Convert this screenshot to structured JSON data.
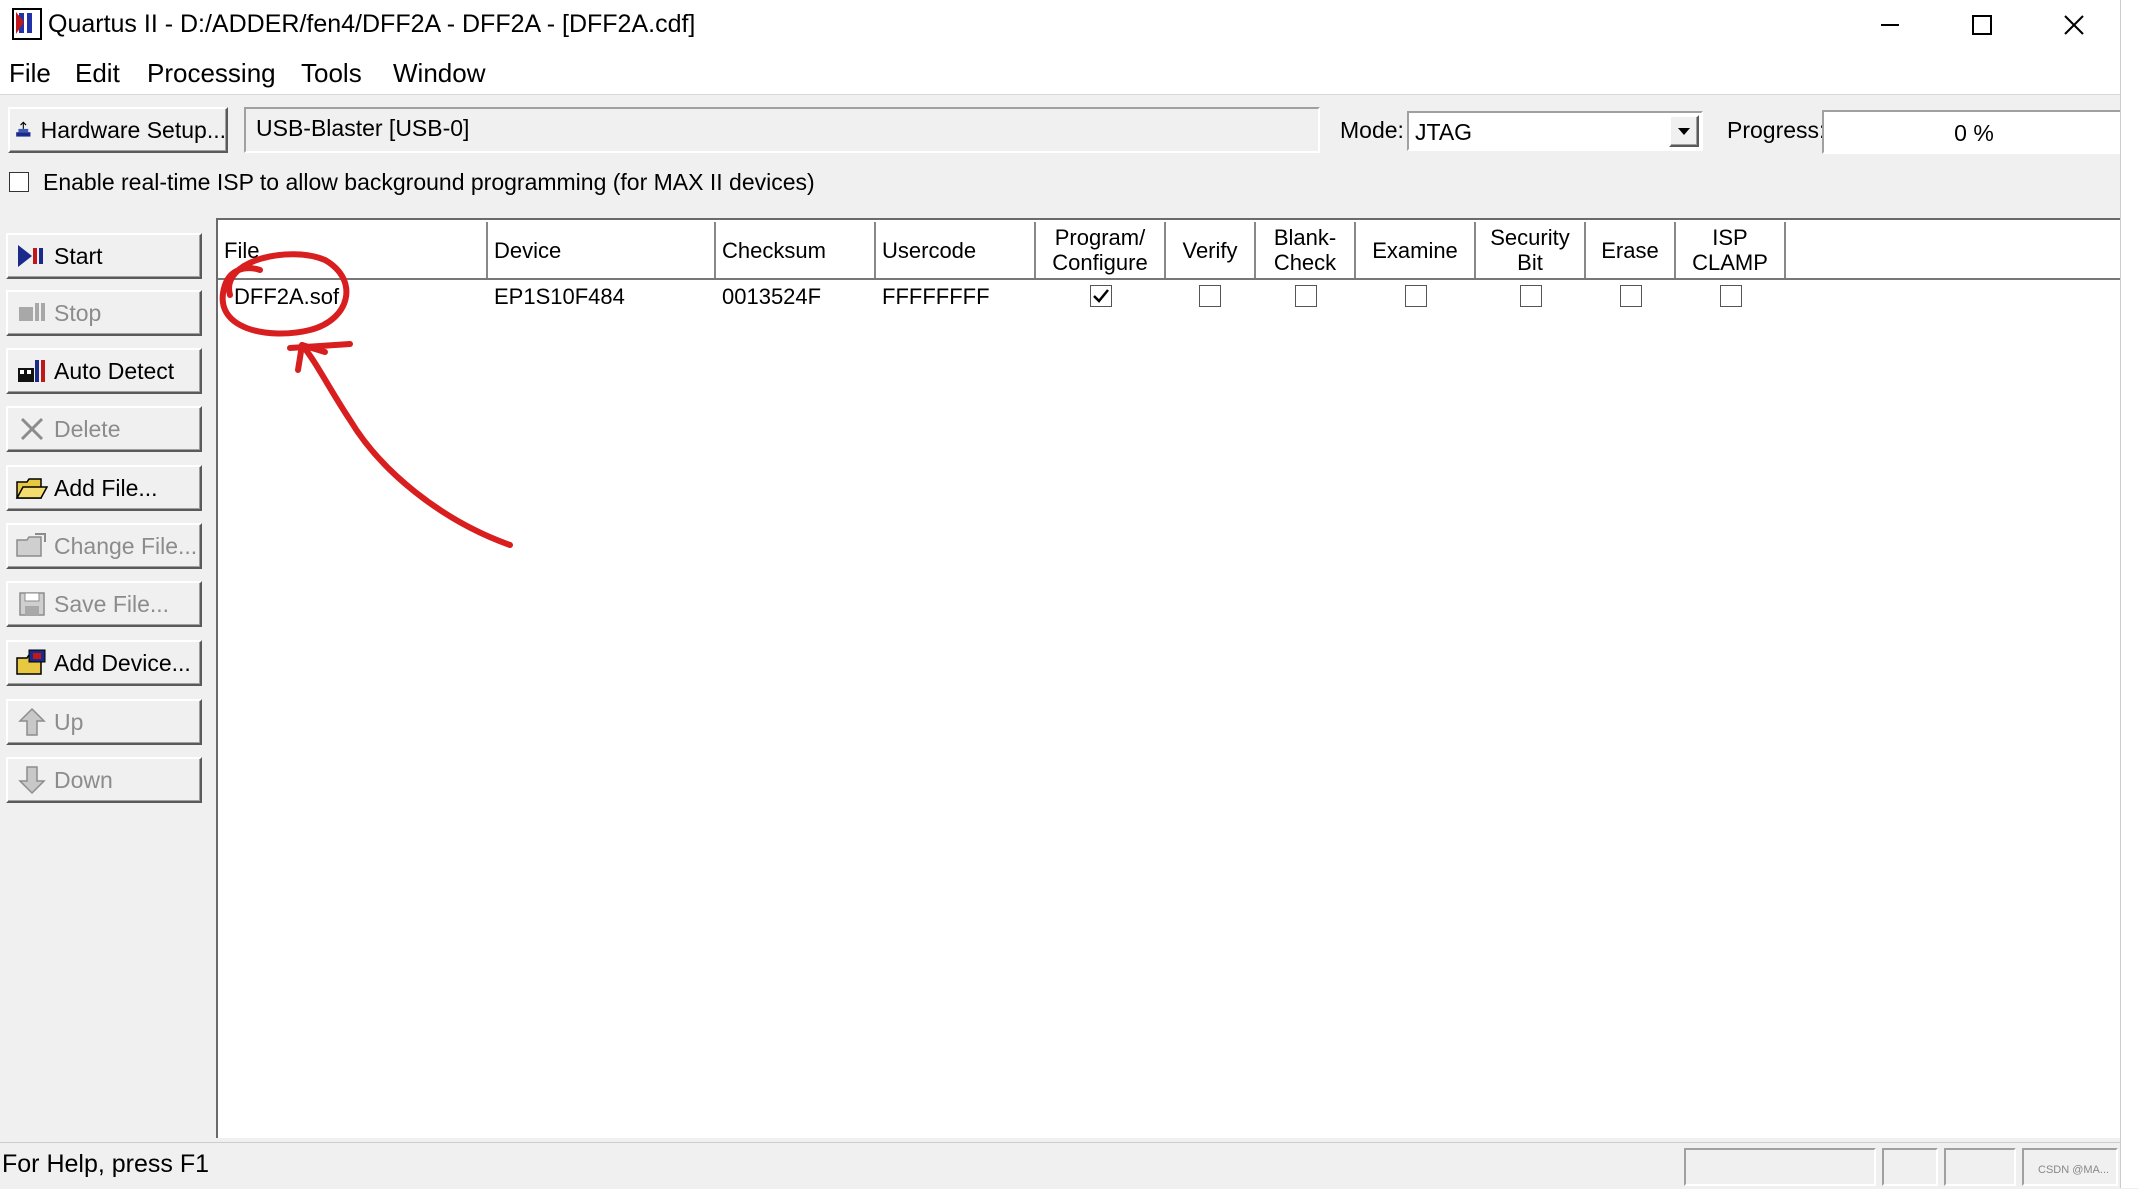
{
  "window": {
    "title": "Quartus II - D:/ADDER/fen4/DFF2A - DFF2A - [DFF2A.cdf]",
    "controls": {
      "minimize": "—",
      "maximize": "☐",
      "close": "✕"
    }
  },
  "menu": [
    "File",
    "Edit",
    "Processing",
    "Tools",
    "Window"
  ],
  "toolbar": {
    "hardware_setup_label": "Hardware Setup...",
    "hardware_value": "USB-Blaster [USB-0]",
    "mode_label": "Mode:",
    "mode_value": "JTAG",
    "progress_label": "Progress:",
    "progress_value": "0 %",
    "isp_label": "Enable real-time ISP to allow background programming (for MAX II devices)",
    "isp_checked": false
  },
  "side_buttons": [
    {
      "label": "Start",
      "enabled": true
    },
    {
      "label": "Stop",
      "enabled": false
    },
    {
      "label": "Auto Detect",
      "enabled": true
    },
    {
      "label": "Delete",
      "enabled": false
    },
    {
      "label": "Add File...",
      "enabled": true
    },
    {
      "label": "Change File...",
      "enabled": false
    },
    {
      "label": "Save File...",
      "enabled": false
    },
    {
      "label": "Add Device...",
      "enabled": true
    },
    {
      "label": "Up",
      "enabled": false
    },
    {
      "label": "Down",
      "enabled": false
    }
  ],
  "table": {
    "columns": [
      "File",
      "Device",
      "Checksum",
      "Usercode",
      "Program/ Configure",
      "Verify",
      "Blank- Check",
      "Examine",
      "Security Bit",
      "Erase",
      "ISP CLAMP"
    ],
    "rows": [
      {
        "file": "DFF2A.sof",
        "device": "EP1S10F484",
        "checksum": "0013524F",
        "usercode": "FFFFFFFF",
        "program_configure": true,
        "verify": false,
        "blank_check": false,
        "examine": false,
        "security_bit": false,
        "erase": false,
        "isp_clamp": false
      }
    ]
  },
  "status": {
    "text": "For Help, press F1",
    "watermark": "CSDN @MA..."
  },
  "annotation_color": "#d81e1e"
}
